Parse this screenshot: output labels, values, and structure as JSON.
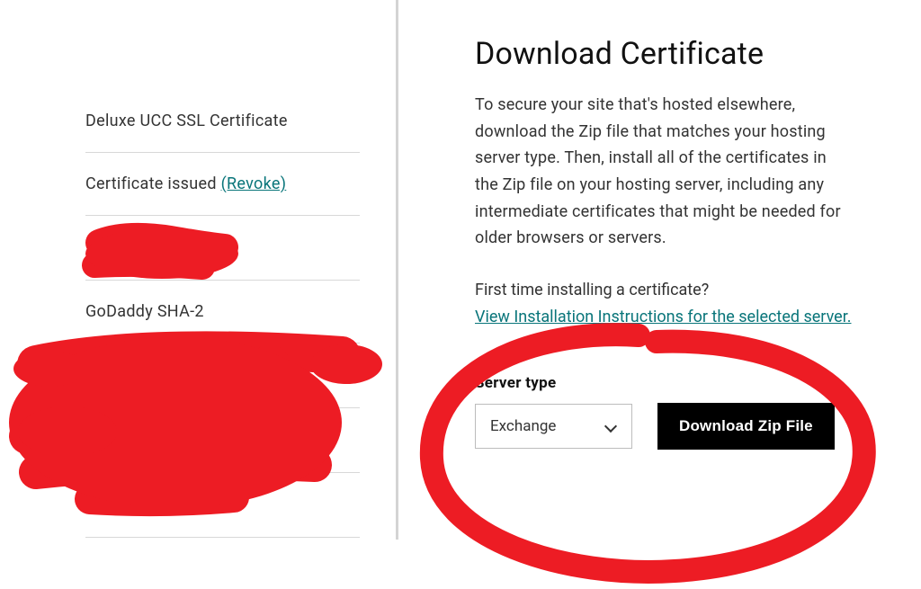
{
  "left": {
    "items": [
      {
        "label": "Deluxe UCC SSL Certificate"
      },
      {
        "label_prefix": "Certificate issued ",
        "revoke_label": "(Revoke)"
      },
      {
        "redacted": true
      },
      {
        "label": "GoDaddy SHA-2"
      },
      {
        "redacted": true
      },
      {
        "redacted": true
      },
      {
        "redacted": true
      }
    ]
  },
  "right": {
    "title": "Download Certificate",
    "description": "To secure your site that's hosted elsewhere, download the Zip file that matches your hosting server type. Then, install all of the certificates in the Zip file on your hosting server, including any intermediate certificates that might be needed for older browsers or servers.",
    "first_time_label": "First time installing a certificate?",
    "install_link_label": "View Installation Instructions for the selected server.",
    "server_type_label": "Server type",
    "server_type_value": "Exchange",
    "download_button_label": "Download Zip File"
  },
  "colors": {
    "link": "#09757a",
    "annotation": "#ed1c24"
  }
}
